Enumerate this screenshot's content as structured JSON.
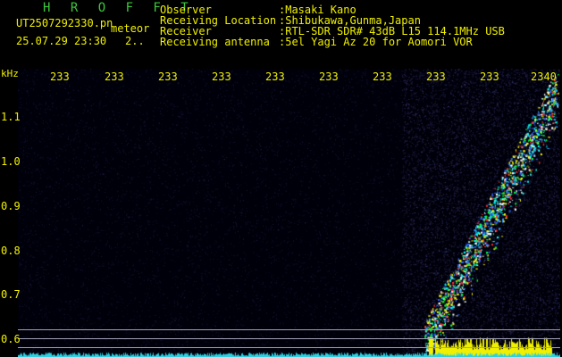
{
  "header": {
    "title": "H R O F F T",
    "filename": "UT2507292330.pn",
    "tag": "meteor",
    "datetime": "25.07.29 23:30",
    "interval": "2..",
    "info": [
      {
        "key": "Observer",
        "value": ":Masaki Kano"
      },
      {
        "key": "Receiving Location",
        "value": ":Shibukawa,Gunma,Japan"
      },
      {
        "key": "Receiver",
        "value": ":RTL-SDR SDR# 43dB L15 114.1MHz USB"
      },
      {
        "key": "Receiving antenna",
        "value": ":5el Yagi Az 20 for Aomori VOR"
      }
    ]
  },
  "y_axis": {
    "unit": "kHz",
    "labels": [
      "1.1",
      "1.0",
      "0.9",
      "0.8",
      "0.7",
      "0.6"
    ]
  },
  "time_axis": {
    "labels": [
      "233",
      "233",
      "233",
      "233",
      "233",
      "233",
      "233",
      "233",
      "233",
      "2340"
    ]
  },
  "colors": {
    "text": "#f0f000",
    "title": "#3cc83c",
    "background": "#000000",
    "noise_spike": "#f0f000",
    "baseline": "#30d0e0"
  }
}
